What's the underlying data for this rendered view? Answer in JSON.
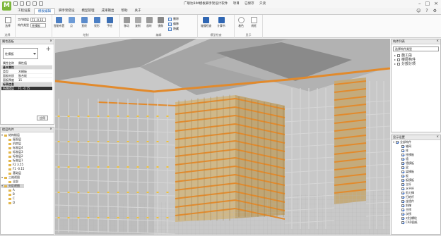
{
  "app": {
    "title_parts": [
      "广联达BIM模板脚手架设计软件",
      "项目",
      "已保存",
      "只读"
    ],
    "logo_letter": "M"
  },
  "menu_tabs": [
    "工程设置",
    "模板编辑",
    "脚手架搭设",
    "模型管理",
    "成果输出",
    "帮助",
    "关于"
  ],
  "active_tab_index": 1,
  "ribbon": {
    "floor_label": "工作楼层",
    "floor_value": "F1 -0.15",
    "component_label": "构件类型",
    "component_value": "柱模板",
    "groups": [
      {
        "label": "选择",
        "buttons": [
          "选择"
        ]
      },
      {
        "label": "绘制",
        "buttons": [
          "智能布置",
          "点",
          "直线",
          "矩形",
          "手绘"
        ]
      },
      {
        "label": "编辑",
        "buttons": [
          "移动",
          "复制",
          "旋转",
          "镜像",
          "删除",
          "偏移"
        ]
      },
      {
        "label": "模型检查",
        "buttons": [
          "碰撞检查",
          "计算书"
        ]
      },
      {
        "label": "显示",
        "buttons": [
          "着色",
          "线框"
        ]
      }
    ],
    "small_buttons": [
      "构件",
      "查找图元",
      "属性",
      "批量选择",
      "隐藏"
    ]
  },
  "properties_panel": {
    "title": "属性面板",
    "combo_value": "柱模板",
    "rows": [
      {
        "k": "属性名称",
        "v": "属性值",
        "type": "head"
      },
      {
        "k": "基本属性",
        "v": "",
        "type": "sec"
      },
      {
        "k": "类型",
        "v": "木模板",
        "type": "row"
      },
      {
        "k": "面板材质",
        "v": "胶合板",
        "type": "row"
      },
      {
        "k": "面板厚度",
        "v": "15",
        "type": "row"
      },
      {
        "k": "标高信息",
        "v": "",
        "type": "sec"
      },
      {
        "k": "所属楼层",
        "v": "F1 -0.15",
        "type": "sel"
      }
    ],
    "apply": "应用"
  },
  "layers_panel": {
    "title": "楼层构件",
    "items": [
      {
        "text": "结构楼层",
        "level": 0,
        "open": true
      },
      {
        "text": "屋面层",
        "level": 1
      },
      {
        "text": "机房层",
        "level": 1
      },
      {
        "text": "标准层4",
        "level": 1
      },
      {
        "text": "标准层3",
        "level": 1
      },
      {
        "text": "标准层2",
        "level": 1
      },
      {
        "text": "标准层1",
        "level": 1
      },
      {
        "text": "F2 3.55",
        "level": 1
      },
      {
        "text": "F1 -0.15",
        "level": 1
      },
      {
        "text": "基础层",
        "level": 1
      },
      {
        "text": "三维视图",
        "level": 0,
        "open": true
      },
      {
        "text": "全部",
        "level": 1
      },
      {
        "text": "分区视图",
        "level": 0,
        "open": true,
        "sel": true
      },
      {
        "text": "A",
        "level": 1
      },
      {
        "text": "B",
        "level": 1
      },
      {
        "text": "C",
        "level": 1
      },
      {
        "text": "D",
        "level": 1
      }
    ]
  },
  "right_top_panel": {
    "title": "构件列表",
    "combo": "选择构件类型",
    "items": [
      "施工段",
      "楼层构件",
      "分部分项"
    ]
  },
  "right_bottom_panel": {
    "title": "显示设置",
    "items": [
      "全部构件",
      "轴网",
      "柱",
      "柱模板",
      "墙",
      "墙模板",
      "梁",
      "梁模板",
      "板",
      "板模板",
      "立杆",
      "水平杆",
      "剪刀撑",
      "扫地杆",
      "连墙件",
      "斜撑",
      "主楞",
      "次楞",
      "对拉螺栓",
      "CAD图纸"
    ]
  },
  "colors": {
    "accent": "#2a6ad8",
    "logo": "#7bb63a",
    "formwork_orange": "#e28a2c",
    "panel_tan": "#cfb889",
    "scaffold_gray": "#d6d6d6"
  }
}
